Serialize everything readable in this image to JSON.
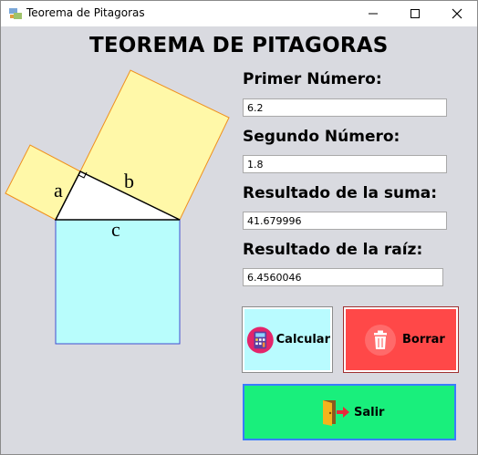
{
  "window": {
    "title": "Teorema de Pitagoras"
  },
  "heading": "TEOREMA DE PITAGORAS",
  "diagram": {
    "label_a": "a",
    "label_b": "b",
    "label_c": "c"
  },
  "form": {
    "first_label": "Primer Número:",
    "first_value": "6.2",
    "second_label": "Segundo Número:",
    "second_value": "1.8",
    "sum_label": "Resultado de la suma:",
    "sum_value": "41.679996",
    "root_label": "Resultado de la raíz:",
    "root_value": "6.4560046"
  },
  "buttons": {
    "calc": "Calcular",
    "clear": "Borrar",
    "exit": "Salir"
  },
  "colors": {
    "square_a": "#fff8a8",
    "square_b": "#fff8a8",
    "square_c": "#b8fdfc",
    "calc_bg": "#b9fbff",
    "clear_bg": "#ff4848",
    "exit_bg": "#19ef7c"
  }
}
